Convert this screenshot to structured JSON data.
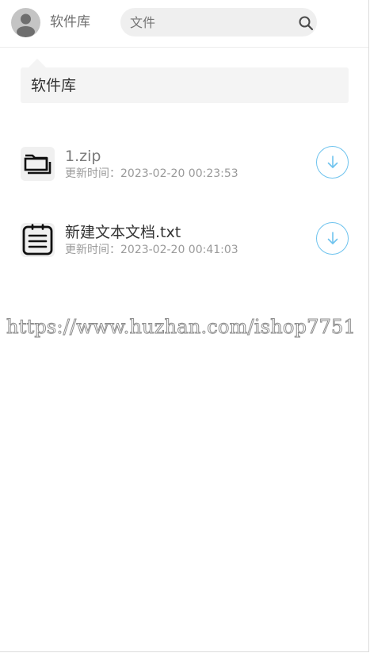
{
  "header": {
    "app_name": "软件库",
    "search": {
      "value": "文件",
      "placeholder": "文件"
    }
  },
  "section": {
    "title": "软件库"
  },
  "files": [
    {
      "name": "1.zip",
      "time_label": "更新时间：",
      "updated": "2023-02-20 00:23:53",
      "icon": "folder-stack-icon",
      "name_color": "#7a7a7a"
    },
    {
      "name": "新建文本文档.txt",
      "time_label": "更新时间：",
      "updated": "2023-02-20 00:41:03",
      "icon": "text-document-icon",
      "name_color": "#333333"
    }
  ],
  "watermark": "https://www.huzhan.com/ishop7751",
  "colors": {
    "accent": "#6ec3ee",
    "card": "#f4f4f4",
    "search_bg": "#efefef"
  }
}
